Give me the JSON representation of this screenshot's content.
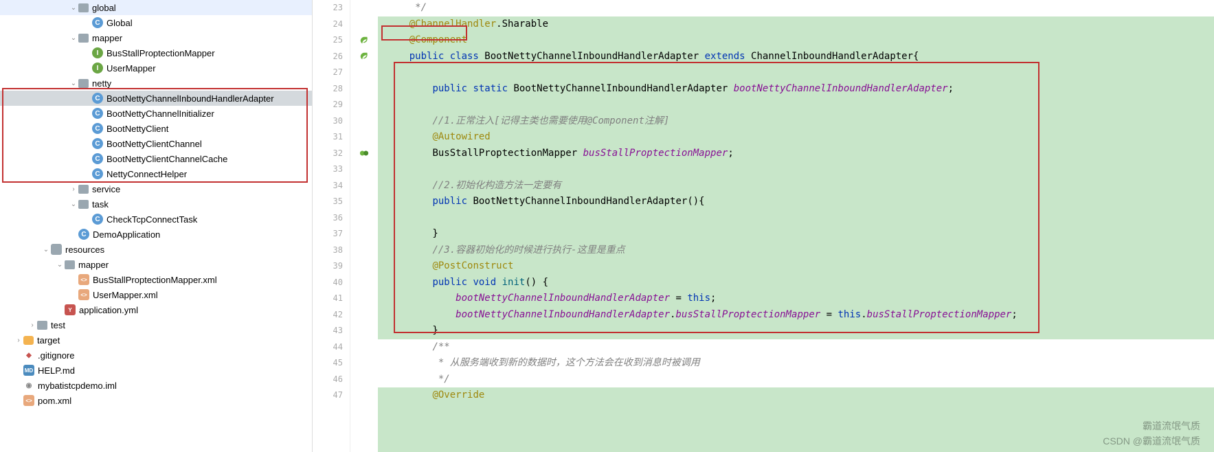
{
  "tree": {
    "items": [
      {
        "indent": 4,
        "chevron": "down",
        "icon": "folder",
        "label": "global"
      },
      {
        "indent": 5,
        "chevron": "none",
        "icon": "class-c",
        "iconText": "C",
        "label": "Global"
      },
      {
        "indent": 4,
        "chevron": "down",
        "icon": "folder",
        "label": "mapper"
      },
      {
        "indent": 5,
        "chevron": "none",
        "icon": "interface-i",
        "iconText": "I",
        "label": "BusStallProptectionMapper"
      },
      {
        "indent": 5,
        "chevron": "none",
        "icon": "interface-i",
        "iconText": "I",
        "label": "UserMapper"
      },
      {
        "indent": 4,
        "chevron": "down",
        "icon": "folder",
        "label": "netty"
      },
      {
        "indent": 5,
        "chevron": "none",
        "icon": "class-c",
        "iconText": "C",
        "label": "BootNettyChannelInboundHandlerAdapter",
        "selected": true
      },
      {
        "indent": 5,
        "chevron": "none",
        "icon": "class-c",
        "iconText": "C",
        "label": "BootNettyChannelInitializer"
      },
      {
        "indent": 5,
        "chevron": "none",
        "icon": "class-c",
        "iconText": "C",
        "label": "BootNettyClient"
      },
      {
        "indent": 5,
        "chevron": "none",
        "icon": "class-c",
        "iconText": "C",
        "label": "BootNettyClientChannel"
      },
      {
        "indent": 5,
        "chevron": "none",
        "icon": "class-c",
        "iconText": "C",
        "label": "BootNettyClientChannelCache"
      },
      {
        "indent": 5,
        "chevron": "none",
        "icon": "class-c",
        "iconText": "C",
        "label": "NettyConnectHelper"
      },
      {
        "indent": 4,
        "chevron": "right",
        "icon": "folder",
        "label": "service"
      },
      {
        "indent": 4,
        "chevron": "down",
        "icon": "folder",
        "label": "task"
      },
      {
        "indent": 5,
        "chevron": "none",
        "icon": "class-c",
        "iconText": "C",
        "label": "CheckTcpConnectTask"
      },
      {
        "indent": 4,
        "chevron": "none",
        "icon": "class-c",
        "iconText": "C",
        "label": "DemoApplication",
        "app": true
      },
      {
        "indent": 2,
        "chevron": "down",
        "icon": "folder-res",
        "label": "resources"
      },
      {
        "indent": 3,
        "chevron": "down",
        "icon": "folder",
        "label": "mapper"
      },
      {
        "indent": 4,
        "chevron": "none",
        "icon": "xml",
        "iconText": "<>",
        "label": "BusStallProptectionMapper.xml"
      },
      {
        "indent": 4,
        "chevron": "none",
        "icon": "xml",
        "iconText": "<>",
        "label": "UserMapper.xml"
      },
      {
        "indent": 3,
        "chevron": "none",
        "icon": "yml",
        "iconText": "Y",
        "label": "application.yml"
      },
      {
        "indent": 1,
        "chevron": "right",
        "icon": "folder",
        "label": "test"
      },
      {
        "indent": 0,
        "chevron": "right",
        "icon": "target",
        "label": "target"
      },
      {
        "indent": 0,
        "chevron": "none",
        "icon": "git",
        "iconText": "◆",
        "label": ".gitignore"
      },
      {
        "indent": 0,
        "chevron": "none",
        "icon": "md",
        "iconText": "MD",
        "label": "HELP.md"
      },
      {
        "indent": 0,
        "chevron": "none",
        "icon": "iml",
        "iconText": "◉",
        "label": "mybatistcpdemo.iml"
      },
      {
        "indent": 0,
        "chevron": "none",
        "icon": "xml",
        "iconText": "<>",
        "label": "pom.xml"
      }
    ]
  },
  "gutter": {
    "start": 23,
    "end": 47,
    "icons": {
      "25": "leaf",
      "26": "leaf",
      "32": "bean"
    }
  },
  "code": {
    "lines": [
      {
        "n": 23,
        "white": true,
        "segs": [
          {
            "t": "     */",
            "c": "comment"
          }
        ]
      },
      {
        "n": 24,
        "segs": [
          {
            "t": "    "
          },
          {
            "t": "@ChannelHandler",
            "c": "anno"
          },
          {
            "t": ".Sharable",
            "c": "cls"
          }
        ]
      },
      {
        "n": 25,
        "segs": [
          {
            "t": "    "
          },
          {
            "t": "@Component",
            "c": "anno"
          }
        ]
      },
      {
        "n": 26,
        "segs": [
          {
            "t": "    "
          },
          {
            "t": "public class ",
            "c": "kw2"
          },
          {
            "t": "BootNettyChannelInboundHandlerAdapter ",
            "c": "cls"
          },
          {
            "t": "extends ",
            "c": "kw2"
          },
          {
            "t": "ChannelInboundHandlerAdapter{",
            "c": "cls"
          }
        ]
      },
      {
        "n": 27,
        "segs": [
          {
            "t": ""
          }
        ]
      },
      {
        "n": 28,
        "segs": [
          {
            "t": "        "
          },
          {
            "t": "public static ",
            "c": "kw2"
          },
          {
            "t": "BootNettyChannelInboundHandlerAdapter ",
            "c": "cls"
          },
          {
            "t": "bootNettyChannelInboundHandlerAdapter",
            "c": "field"
          },
          {
            "t": ";",
            "c": "cls"
          }
        ]
      },
      {
        "n": 29,
        "segs": [
          {
            "t": ""
          }
        ]
      },
      {
        "n": 30,
        "segs": [
          {
            "t": "        "
          },
          {
            "t": "//1.正常注入[记得主类也需要使用@Component注解]",
            "c": "comment"
          }
        ]
      },
      {
        "n": 31,
        "segs": [
          {
            "t": "        "
          },
          {
            "t": "@Autowired",
            "c": "anno"
          }
        ]
      },
      {
        "n": 32,
        "segs": [
          {
            "t": "        "
          },
          {
            "t": "BusStallProptectionMapper ",
            "c": "cls"
          },
          {
            "t": "busStallProptectionMapper",
            "c": "field"
          },
          {
            "t": ";",
            "c": "cls"
          }
        ]
      },
      {
        "n": 33,
        "segs": [
          {
            "t": ""
          }
        ]
      },
      {
        "n": 34,
        "segs": [
          {
            "t": "        "
          },
          {
            "t": "//2.初始化构造方法一定要有",
            "c": "comment"
          }
        ]
      },
      {
        "n": 35,
        "segs": [
          {
            "t": "        "
          },
          {
            "t": "public ",
            "c": "kw2"
          },
          {
            "t": "BootNettyChannelInboundHandlerAdapter",
            "c": "cls"
          },
          {
            "t": "(){",
            "c": "cls"
          }
        ]
      },
      {
        "n": 36,
        "segs": [
          {
            "t": ""
          }
        ]
      },
      {
        "n": 37,
        "segs": [
          {
            "t": "        }",
            "c": "cls"
          }
        ]
      },
      {
        "n": 38,
        "segs": [
          {
            "t": "        "
          },
          {
            "t": "//3.容器初始化的时候进行执行-这里是重点",
            "c": "comment"
          }
        ]
      },
      {
        "n": 39,
        "segs": [
          {
            "t": "        "
          },
          {
            "t": "@PostConstruct",
            "c": "anno"
          }
        ]
      },
      {
        "n": 40,
        "segs": [
          {
            "t": "        "
          },
          {
            "t": "public void ",
            "c": "kw2"
          },
          {
            "t": "init",
            "c": "method"
          },
          {
            "t": "() {",
            "c": "cls"
          }
        ]
      },
      {
        "n": 41,
        "segs": [
          {
            "t": "            "
          },
          {
            "t": "bootNettyChannelInboundHandlerAdapter",
            "c": "field"
          },
          {
            "t": " = ",
            "c": "cls"
          },
          {
            "t": "this",
            "c": "kw2"
          },
          {
            "t": ";",
            "c": "cls"
          }
        ]
      },
      {
        "n": 42,
        "segs": [
          {
            "t": "            "
          },
          {
            "t": "bootNettyChannelInboundHandlerAdapter",
            "c": "field"
          },
          {
            "t": ".",
            "c": "cls"
          },
          {
            "t": "busStallProptectionMapper",
            "c": "field"
          },
          {
            "t": " = ",
            "c": "cls"
          },
          {
            "t": "this",
            "c": "kw2"
          },
          {
            "t": ".",
            "c": "cls"
          },
          {
            "t": "busStallProptectionMapper",
            "c": "field"
          },
          {
            "t": ";",
            "c": "cls"
          }
        ]
      },
      {
        "n": 43,
        "segs": [
          {
            "t": "        }",
            "c": "cls"
          }
        ]
      },
      {
        "n": 44,
        "white": true,
        "segs": [
          {
            "t": "        "
          },
          {
            "t": "/**",
            "c": "comment"
          }
        ]
      },
      {
        "n": 45,
        "white": true,
        "segs": [
          {
            "t": "         * 从服务端收到新的数据时，这个方法会在收到消息时被调用",
            "c": "comment"
          }
        ]
      },
      {
        "n": 46,
        "white": true,
        "segs": [
          {
            "t": "         */",
            "c": "comment"
          }
        ]
      },
      {
        "n": 47,
        "segs": [
          {
            "t": "        "
          },
          {
            "t": "@Override",
            "c": "anno"
          }
        ]
      }
    ]
  },
  "watermark": {
    "line1": "霸道流氓气质",
    "line2": "CSDN @霸道流氓气质"
  }
}
